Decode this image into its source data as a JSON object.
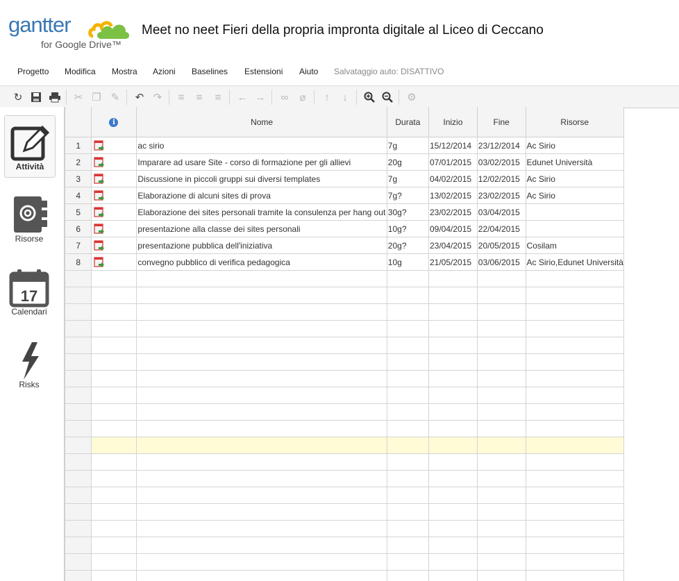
{
  "logo": {
    "word": "gantter",
    "sub": "for Google Drive™"
  },
  "document": {
    "title": "Meet no neet Fieri della propria impronta digitale al Liceo di Ceccano"
  },
  "menu": {
    "items": [
      "Progetto",
      "Modifica",
      "Mostra",
      "Azioni",
      "Baselines",
      "Estensioni",
      "Aiuto"
    ],
    "autosave": "Salvataggio auto: DISATTIVO"
  },
  "toolbar": {
    "buttons": [
      "refresh-icon",
      "save-icon",
      "print-icon",
      "cut-icon",
      "copy-icon",
      "paste-format-icon",
      "undo-icon",
      "redo-icon",
      "indent-icon",
      "outdent-icon",
      "summary-icon",
      "arrow-left-icon",
      "arrow-right-icon",
      "link-icon",
      "unlink-icon",
      "move-up-icon",
      "move-down-icon",
      "zoom-in-icon",
      "zoom-out-icon",
      "settings-icon"
    ]
  },
  "sidebar": {
    "items": [
      {
        "label": "Attività",
        "icon": "edit-icon"
      },
      {
        "label": "Risorse",
        "icon": "address-book-icon"
      },
      {
        "label": "Calendari",
        "icon": "calendar-icon",
        "day": "17"
      },
      {
        "label": "Risks",
        "icon": "lightning-icon"
      }
    ]
  },
  "grid": {
    "columns": {
      "info": "i",
      "name": "Nome",
      "duration": "Durata",
      "start": "Inizio",
      "end": "Fine",
      "resources": "Risorse"
    },
    "rows": [
      {
        "n": "1",
        "name": "ac sirio",
        "duration": "7g",
        "start": "15/12/2014",
        "end": "23/12/2014",
        "resources": "Ac Sirio"
      },
      {
        "n": "2",
        "name": "Imparare ad usare Site - corso di formazione per gli allievi",
        "duration": "20g",
        "start": "07/01/2015",
        "end": "03/02/2015",
        "resources": "Edunet Università"
      },
      {
        "n": "3",
        "name": "Discussione in piccoli gruppi sui diversi templates",
        "duration": "7g",
        "start": "04/02/2015",
        "end": "12/02/2015",
        "resources": "Ac Sirio"
      },
      {
        "n": "4",
        "name": "Elaborazione di alcuni sites di prova",
        "duration": "7g?",
        "start": "13/02/2015",
        "end": "23/02/2015",
        "resources": "Ac Sirio"
      },
      {
        "n": "5",
        "name": "Elaborazione dei sites personali tramite la consulenza per hang out",
        "duration": "30g?",
        "start": "23/02/2015",
        "end": "03/04/2015",
        "resources": ""
      },
      {
        "n": "6",
        "name": "presentazione alla classe dei sites personali",
        "duration": "10g?",
        "start": "09/04/2015",
        "end": "22/04/2015",
        "resources": ""
      },
      {
        "n": "7",
        "name": "presentazione pubblica dell'iniziativa",
        "duration": "20g?",
        "start": "23/04/2015",
        "end": "20/05/2015",
        "resources": "Cosilam"
      },
      {
        "n": "8",
        "name": "convegno pubblico di verifica pedagogica",
        "duration": "10g",
        "start": "21/05/2015",
        "end": "03/06/2015",
        "resources": "Ac Sirio,Edunet Università"
      }
    ],
    "empty_rows": 19,
    "highlight_empty_index": 10
  },
  "colors": {
    "brand_blue": "#3a78b5",
    "cloud_green": "#7bc143",
    "cloud_yellow": "#f4b400",
    "highlight_row": "#fffbd6"
  }
}
